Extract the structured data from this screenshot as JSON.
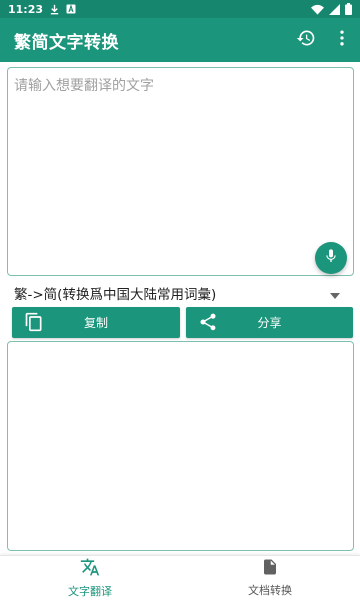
{
  "status_bar": {
    "time": "11:23",
    "icons": [
      "download-icon",
      "app-notification-icon",
      "wifi-icon",
      "signal-icon",
      "battery-icon"
    ]
  },
  "app_bar": {
    "title": "繁简文字转换",
    "actions": [
      "history-icon",
      "more-vert-icon"
    ]
  },
  "input": {
    "placeholder": "请输入想要翻译的文字",
    "value": "",
    "mic_icon": "mic-icon"
  },
  "mode": {
    "selected": "繁->简(转换爲中国大陆常用词彙)"
  },
  "buttons": {
    "copy_label": "复制",
    "share_label": "分享"
  },
  "output": {
    "value": ""
  },
  "bottom_nav": {
    "items": [
      {
        "label": "文字翻译",
        "icon": "translate-icon",
        "active": true
      },
      {
        "label": "文档转换",
        "icon": "document-icon",
        "active": false
      }
    ]
  },
  "colors": {
    "primary": "#1b957b",
    "primary_dark": "#16876e",
    "border": "#7fbfb0"
  }
}
